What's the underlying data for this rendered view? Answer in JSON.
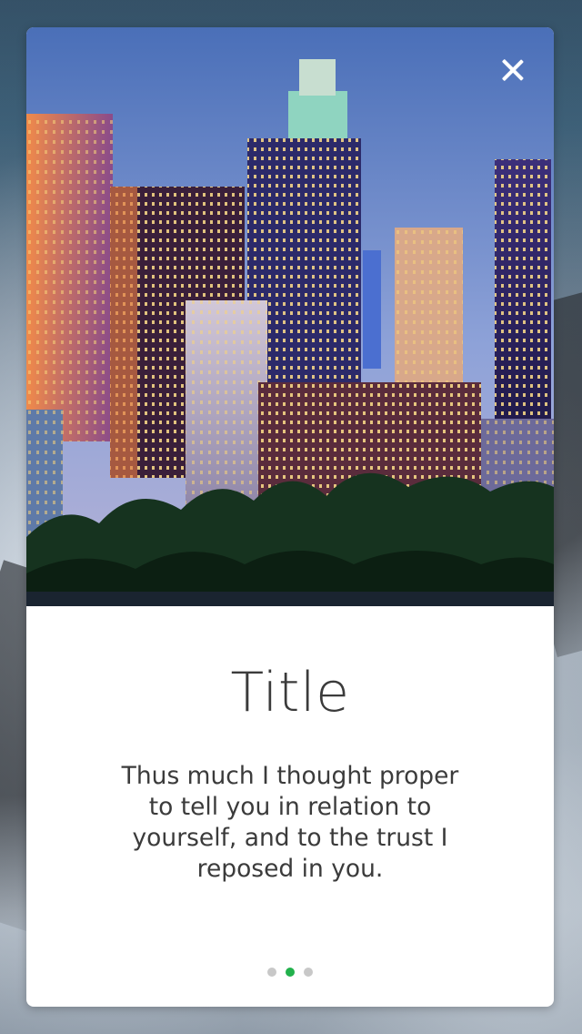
{
  "modal": {
    "close_icon": "close-icon",
    "image": "city-skyline-photo",
    "title": "Title",
    "body": "Thus much I thought proper to tell you in relation to yourself, and to the trust I reposed in you.",
    "page_indicator": {
      "total": 3,
      "active_index": 1,
      "active_color": "#22b14c",
      "inactive_color": "#c8c8c8"
    }
  }
}
